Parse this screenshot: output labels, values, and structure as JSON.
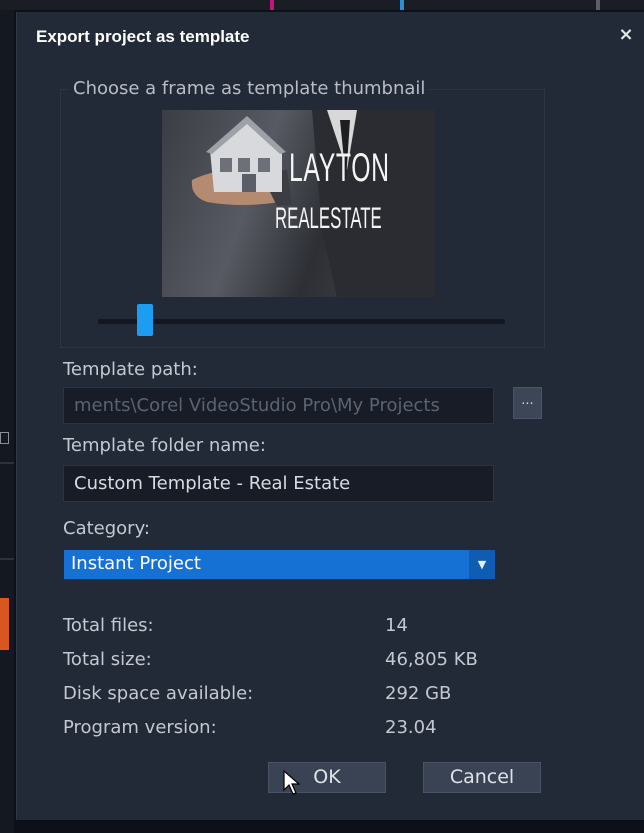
{
  "dialog": {
    "title": "Export project as template",
    "close_icon": "×"
  },
  "thumbnail": {
    "legend": "Choose a frame as template thumbnail",
    "image_text_line1": "LAYTON",
    "image_text_line2": "REALESTATE",
    "slider_position": 0.1
  },
  "path": {
    "label": "Template path:",
    "value": "ments\\Corel VideoStudio Pro\\My Projects",
    "browse_label": "..."
  },
  "folder": {
    "label": "Template folder name:",
    "value": "Custom Template - Real Estate"
  },
  "category": {
    "label": "Category:",
    "selected": "Instant Project",
    "arrow_icon": "▼"
  },
  "stats": {
    "total_files_label": "Total files:",
    "total_files_value": "14",
    "total_size_label": "Total size:",
    "total_size_value": "46,805 KB",
    "disk_space_label": "Disk space available:",
    "disk_space_value": "292 GB",
    "program_version_label": "Program version:",
    "program_version_value": "23.04"
  },
  "buttons": {
    "ok_label": "OK",
    "cancel_label": "Cancel"
  },
  "colors": {
    "dialog_bg": "#222a37",
    "accent": "#1c9cf2",
    "selection": "#1571d4",
    "orange_clip": "#d9561e"
  }
}
